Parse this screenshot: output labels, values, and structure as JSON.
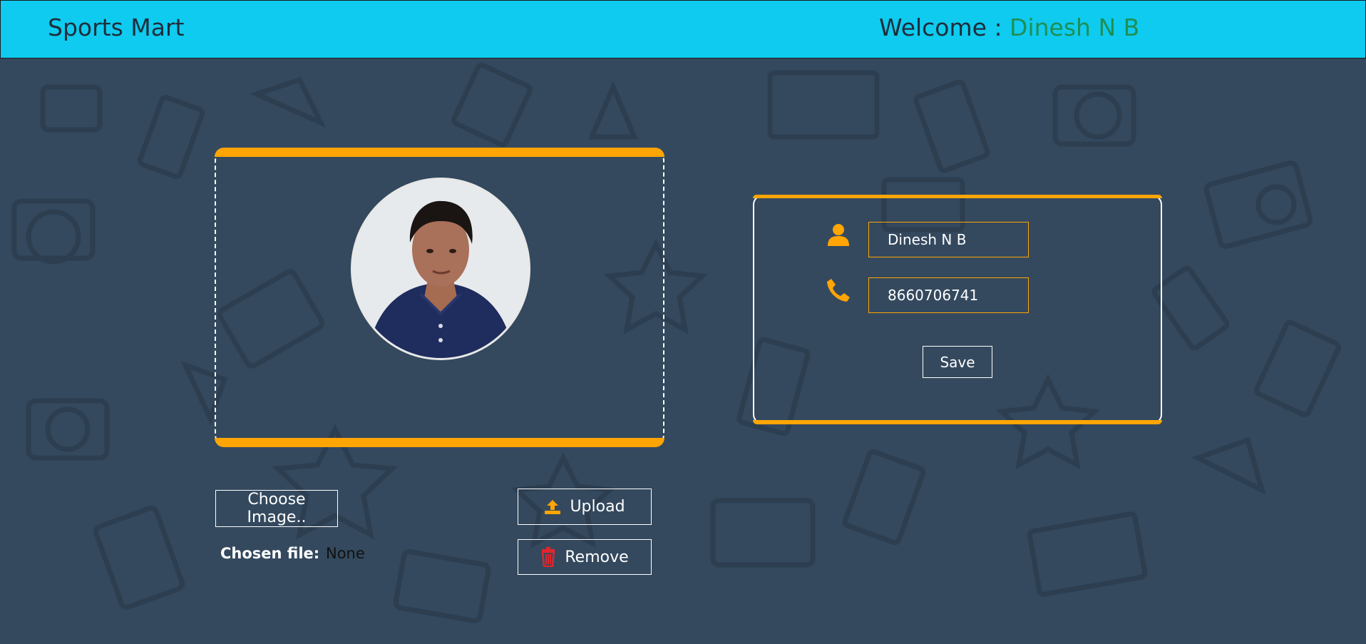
{
  "header": {
    "brand": "Sports Mart",
    "welcome_label": "Welcome : ",
    "user_name": "Dinesh N B"
  },
  "profile_photo": {
    "alt": "Profile photo of a young man in a navy shirt"
  },
  "file_picker": {
    "choose_label": "Choose Image..",
    "chosen_label": "Chosen file:",
    "chosen_value": "None"
  },
  "actions": {
    "upload_label": "Upload",
    "remove_label": "Remove"
  },
  "form": {
    "name_value": "Dinesh N B",
    "phone_value": "8660706741",
    "save_label": "Save"
  },
  "icons": {
    "name_field": "user-icon",
    "phone_field": "phone-icon",
    "upload": "upload-icon",
    "remove": "trash-icon"
  },
  "colors": {
    "header_bg": "#0ecbef",
    "page_bg": "#34495e",
    "accent": "#ffa505",
    "username": "#1f8f55",
    "remove_icon": "#e0262d"
  }
}
